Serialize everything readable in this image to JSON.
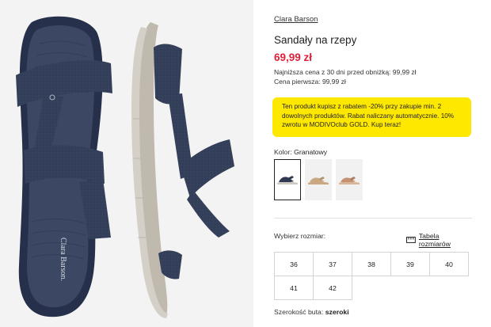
{
  "product": {
    "brand": "Clara Barson",
    "title": "Sandały na rzepy",
    "price": "69,99 zł",
    "lowest_price_line": "Najniższa cena z 30 dni przed obniżką: 99,99 zł",
    "first_price_line": "Cena pierwsza: 99,99 zł",
    "image_brand_print": "Clara Barson."
  },
  "promo": {
    "text": "Ten produkt kupisz z rabatem -20% przy zakupie min. 2 dowolnych produktów. Rabat naliczany automatycznie. 10% zwrotu w MODIVOclub GOLD. Kup teraz!",
    "background": "#ffe800"
  },
  "color": {
    "label": "Kolor:",
    "value": "Granatowy",
    "swatches": [
      {
        "name": "navy",
        "color": "#2f3a52",
        "selected": true
      },
      {
        "name": "beige",
        "color": "#c9a882",
        "selected": false
      },
      {
        "name": "tan",
        "color": "#c49270",
        "selected": false
      }
    ]
  },
  "size": {
    "label": "Wybierz rozmiar:",
    "guide_label": "Tabela rozmiarów",
    "options": [
      "36",
      "37",
      "38",
      "39",
      "40",
      "41",
      "42"
    ]
  },
  "width": {
    "label": "Szerokość buta:",
    "value": "szeroki"
  },
  "colors": {
    "price": "#e0203a",
    "promo": "#ffe800",
    "strap": "#2f3a52",
    "sole": "#bfb9ae"
  }
}
